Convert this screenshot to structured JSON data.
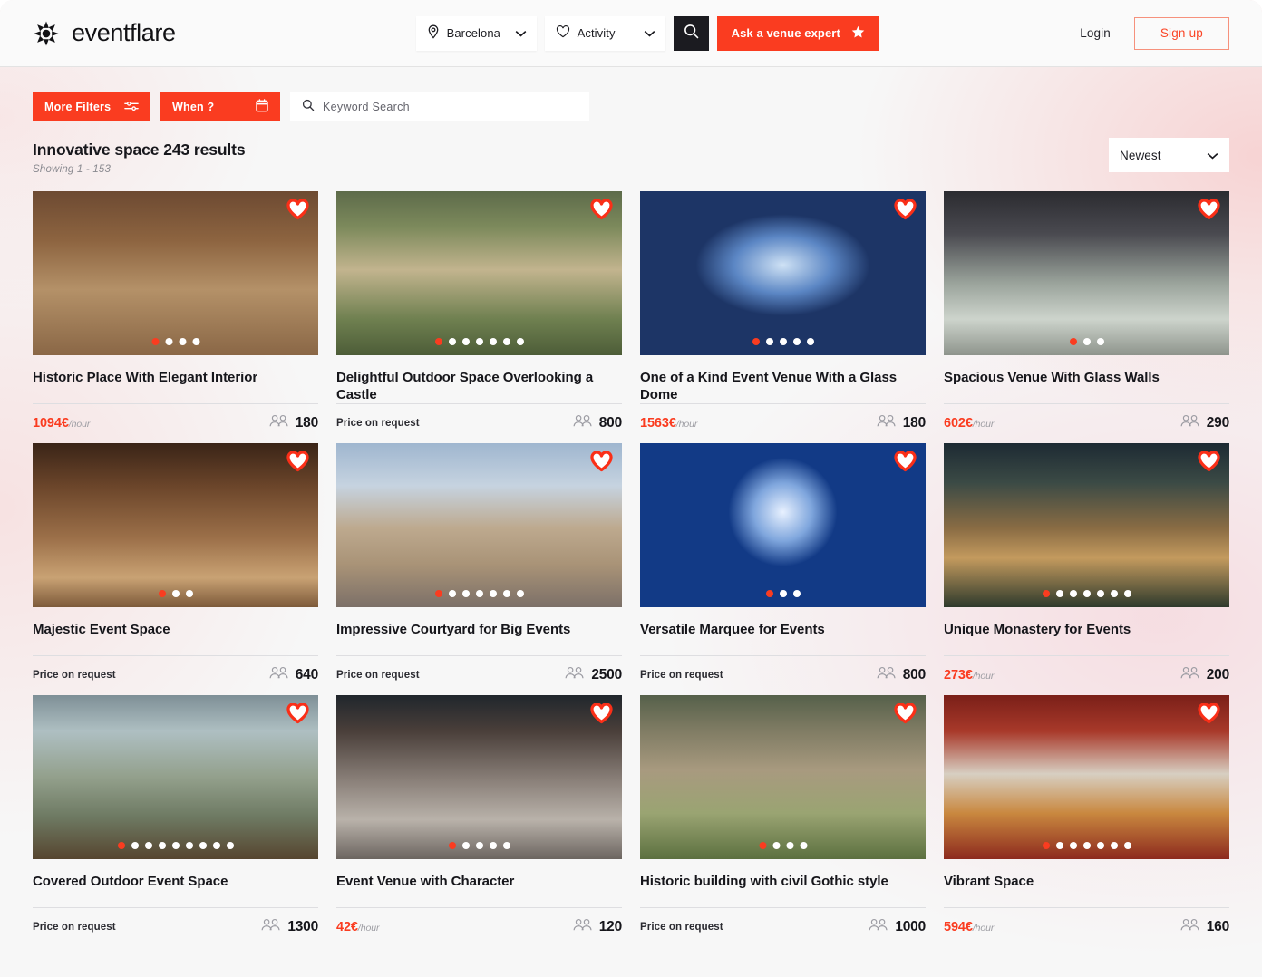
{
  "brand": {
    "name": "eventflare",
    "logo_icon": "eventflare-asterisk-logo"
  },
  "nav": {
    "city_select": {
      "value": "Barcelona",
      "icon": "map-pin-icon",
      "chevron": "chevron-down-icon"
    },
    "activity_select": {
      "value": "Activity",
      "icon": "heart-icon",
      "chevron": "chevron-down-icon"
    },
    "search_button": {
      "icon": "search-icon"
    },
    "expert_button": {
      "label": "Ask a venue expert",
      "icon": "star-icon",
      "color": "#fa3c20"
    },
    "login_label": "Login",
    "signup_label": "Sign up"
  },
  "filters": {
    "more_filters": {
      "label": "More Filters",
      "icon": "sliders-icon"
    },
    "when": {
      "label": "When ?",
      "icon": "calendar-icon"
    },
    "keyword": {
      "placeholder": "Keyword Search",
      "value": "",
      "icon": "search-icon"
    }
  },
  "results": {
    "title": "Innovative space 243 results",
    "subtitle": "Showing 1 - 153",
    "sort": {
      "value": "Newest",
      "chevron": "chevron-down-icon"
    }
  },
  "colors": {
    "accent": "#fa3c20",
    "page_bg": "#f7f7f7",
    "topbar_bg": "#fafafa",
    "text": "#16161b"
  },
  "cards": [
    {
      "title": "Historic Place With Elegant Interior",
      "price": "1094€",
      "price_unit": "/hour",
      "price_on_request": false,
      "capacity": "180",
      "dots_total": 4,
      "dots_active": 0,
      "favorite_icon": "heart-icon",
      "capacity_icon": "people-icon",
      "image_alt": "historic banquet hall with long dressed tables and wooden walls"
    },
    {
      "title": "Delightful Outdoor Space Overlooking a Castle",
      "price": "",
      "price_unit": "",
      "price_on_request": true,
      "price_request_label": "Price on request",
      "capacity": "800",
      "dots_total": 7,
      "dots_active": 0,
      "favorite_icon": "heart-icon",
      "capacity_icon": "people-icon",
      "image_alt": "formal garden with rows of white chairs facing a castle"
    },
    {
      "title": "One of a Kind Event Venue With a Glass Dome",
      "price": "1563€",
      "price_unit": "/hour",
      "price_on_request": false,
      "capacity": "180",
      "dots_total": 5,
      "dots_active": 0,
      "favorite_icon": "heart-icon",
      "capacity_icon": "people-icon",
      "image_alt": "illuminated glass dome venue at night above city lights"
    },
    {
      "title": "Spacious Venue With Glass Walls",
      "price": "602€",
      "price_unit": "/hour",
      "price_on_request": false,
      "capacity": "290",
      "dots_total": 3,
      "dots_active": 0,
      "favorite_icon": "heart-icon",
      "capacity_icon": "people-icon",
      "image_alt": "dark steel and glass atrium with sculptural ceiling"
    },
    {
      "title": "Majestic Event Space",
      "price": "",
      "price_unit": "",
      "price_on_request": true,
      "price_request_label": "Price on request",
      "capacity": "640",
      "dots_total": 3,
      "dots_active": 0,
      "favorite_icon": "heart-icon",
      "capacity_icon": "people-icon",
      "image_alt": "stone gothic vaulted hall with arches"
    },
    {
      "title": "Impressive Courtyard for Big Events",
      "price": "",
      "price_unit": "",
      "price_on_request": true,
      "price_request_label": "Price on request",
      "capacity": "2500",
      "dots_total": 7,
      "dots_active": 0,
      "favorite_icon": "heart-icon",
      "capacity_icon": "people-icon",
      "image_alt": "historic village square with arcaded buildings under a cloudy sky"
    },
    {
      "title": "Versatile Marquee for Events",
      "price": "",
      "price_unit": "",
      "price_on_request": true,
      "price_request_label": "Price on request",
      "capacity": "800",
      "dots_total": 3,
      "dots_active": 0,
      "favorite_icon": "heart-icon",
      "capacity_icon": "people-icon",
      "image_alt": "blue lit marquee hall with round banquet tables and disco ball"
    },
    {
      "title": "Unique Monastery for Events",
      "price": "273€",
      "price_unit": "/hour",
      "price_on_request": false,
      "capacity": "200",
      "dots_total": 7,
      "dots_active": 0,
      "favorite_icon": "heart-icon",
      "capacity_icon": "people-icon",
      "image_alt": "floodlit monastery at dusk surrounded by trees"
    },
    {
      "title": "Covered Outdoor Event Space",
      "price": "",
      "price_unit": "",
      "price_on_request": true,
      "price_request_label": "Price on request",
      "capacity": "1300",
      "dots_total": 9,
      "dots_active": 0,
      "favorite_icon": "heart-icon",
      "capacity_icon": "people-icon",
      "image_alt": "glass roofed courtyard with hanging greenery and planters"
    },
    {
      "title": "Event Venue with Character",
      "price": "42€",
      "price_unit": "/hour",
      "price_on_request": false,
      "capacity": "120",
      "dots_total": 5,
      "dots_active": 0,
      "favorite_icon": "heart-icon",
      "capacity_icon": "people-icon",
      "image_alt": "industrial brick corridor with blue stairs and concrete floor"
    },
    {
      "title": "Historic building with civil Gothic style",
      "price": "",
      "price_unit": "",
      "price_on_request": true,
      "price_request_label": "Price on request",
      "capacity": "1000",
      "dots_total": 4,
      "dots_active": 0,
      "favorite_icon": "heart-icon",
      "capacity_icon": "people-icon",
      "image_alt": "stone facade of a gothic hall beside a green lawn"
    },
    {
      "title": "Vibrant Space",
      "price": "594€",
      "price_unit": "/hour",
      "price_on_request": false,
      "capacity": "160",
      "dots_total": 7,
      "dots_active": 0,
      "favorite_icon": "heart-icon",
      "capacity_icon": "people-icon",
      "image_alt": "red walled conference room with u-shaped table and projection screen"
    }
  ]
}
